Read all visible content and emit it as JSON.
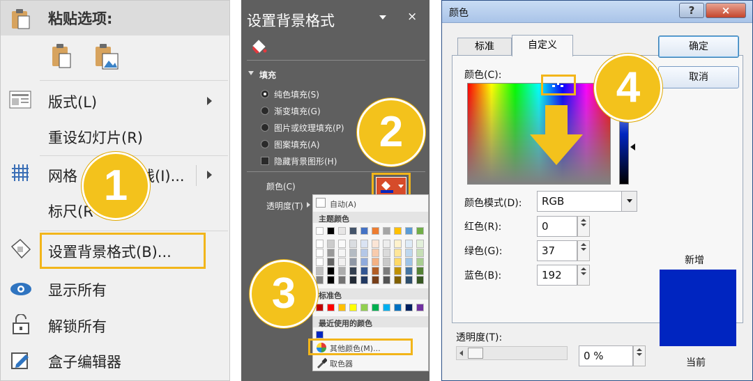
{
  "menu": {
    "paste_header": "粘贴选项:",
    "items": [
      {
        "label": "版式(L)"
      },
      {
        "label": "重设幻灯片(R)"
      },
      {
        "label": "网格和参考线(I)..."
      },
      {
        "label": "标尺(R)"
      },
      {
        "label": "设置背景格式(B)..."
      },
      {
        "label": "显示所有"
      },
      {
        "label": "解锁所有"
      },
      {
        "label": "盒子编辑器"
      }
    ],
    "grid_visible": "网格",
    "grid_suffix": "线(I)...",
    "ruler_visible": "标尺(R"
  },
  "format_pane": {
    "title": "设置背景格式",
    "section": "填充",
    "options": [
      "纯色填充(S)",
      "渐变填充(G)",
      "图片或纹理填充(P)",
      "图案填充(A)"
    ],
    "hide_graphics": "隐藏背景图形(H)",
    "color_label": "颜色(C)",
    "transparency_label": "透明度(T)",
    "close": "×"
  },
  "palette": {
    "auto": "自动(A)",
    "theme": "主题颜色",
    "standard": "标准色",
    "recent": "最近使用的颜色",
    "more": "其他颜色(M)...",
    "eyedropper": "取色器",
    "theme_colors": [
      "#ffffff",
      "#000000",
      "#e7e6e6",
      "#44546a",
      "#4472c4",
      "#ed7d31",
      "#a5a5a5",
      "#ffc000",
      "#5b9bd5",
      "#70ad47"
    ],
    "standard_colors": [
      "#c00000",
      "#ff0000",
      "#ffc000",
      "#ffff00",
      "#92d050",
      "#00b050",
      "#00b0f0",
      "#0070c0",
      "#002060",
      "#7030a0"
    ],
    "recent_colors": [
      "#0025c0"
    ]
  },
  "dialog": {
    "title": "颜色",
    "tabs": [
      "标准",
      "自定义"
    ],
    "ok": "确定",
    "cancel": "取消",
    "colors_label": "颜色(C):",
    "mode_label": "颜色模式(D):",
    "mode_value": "RGB",
    "red_label": "红色(R):",
    "green_label": "绿色(G):",
    "blue_label": "蓝色(B):",
    "red": "0",
    "green": "37",
    "blue": "192",
    "transparency_label": "透明度(T):",
    "transparency_value": "0 %",
    "new_label": "新增",
    "current_label": "当前",
    "selected_color": "#0025c0",
    "help": "?",
    "close": "×"
  },
  "callouts": [
    "1",
    "2",
    "3",
    "4"
  ],
  "accent": "#f3c21c"
}
